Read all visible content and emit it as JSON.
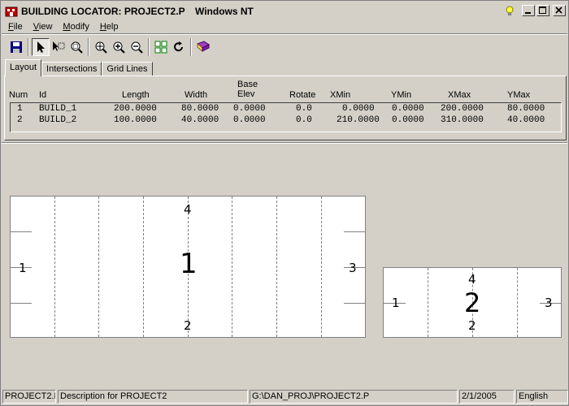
{
  "window": {
    "title": "BUILDING LOCATOR: PROJECT2.P",
    "os_label": "Windows NT"
  },
  "menu": [
    {
      "label": "File",
      "accel": "F",
      "rest": "ile"
    },
    {
      "label": "View",
      "accel": "V",
      "rest": "iew"
    },
    {
      "label": "Modify",
      "accel": "M",
      "rest": "odify"
    },
    {
      "label": "Help",
      "accel": "H",
      "rest": "elp"
    }
  ],
  "toolbar": {
    "icons": [
      "save-icon",
      "pointer-icon",
      "edit-icon",
      "zoom-window-icon",
      "zoom-all-icon",
      "zoom-in-icon",
      "zoom-out-icon",
      "grid-icon",
      "refresh-icon",
      "book-icon"
    ]
  },
  "tabs": [
    "Layout",
    "Intersections",
    "Grid Lines"
  ],
  "table": {
    "headers": {
      "num": "Num",
      "id": "Id",
      "length": "Length",
      "width": "Width",
      "base_elev_1": "Base",
      "base_elev_2": "Elev",
      "rotate": "Rotate",
      "xmin": "XMin",
      "ymin": "YMin",
      "xmax": "XMax",
      "ymax": "YMax"
    },
    "rows": [
      {
        "num": "1",
        "id": "BUILD_1",
        "length": "200.0000",
        "width": "80.0000",
        "elev": "0.0000",
        "rotate": "0.0",
        "xmin": "0.0000",
        "ymin": "0.0000",
        "xmax": "200.0000",
        "ymax": "80.0000"
      },
      {
        "num": "2",
        "id": "BUILD_2",
        "length": "100.0000",
        "width": "40.0000",
        "elev": "0.0000",
        "rotate": "0.0",
        "xmin": "210.0000",
        "ymin": "0.0000",
        "xmax": "310.0000",
        "ymax": "40.0000"
      }
    ]
  },
  "canvas": {
    "building1": {
      "label": "1",
      "side_left": "1",
      "side_bottom": "2",
      "side_right": "3",
      "side_top": "4"
    },
    "building2": {
      "label": "2",
      "side_left": "1",
      "side_bottom": "2",
      "side_right": "3",
      "side_top": "4"
    }
  },
  "status": {
    "project": "PROJECT2.P",
    "description": "Description for PROJECT2",
    "path": "G:\\DAN_PROJ\\PROJECT2.P",
    "date": "2/1/2005",
    "language": "English"
  }
}
